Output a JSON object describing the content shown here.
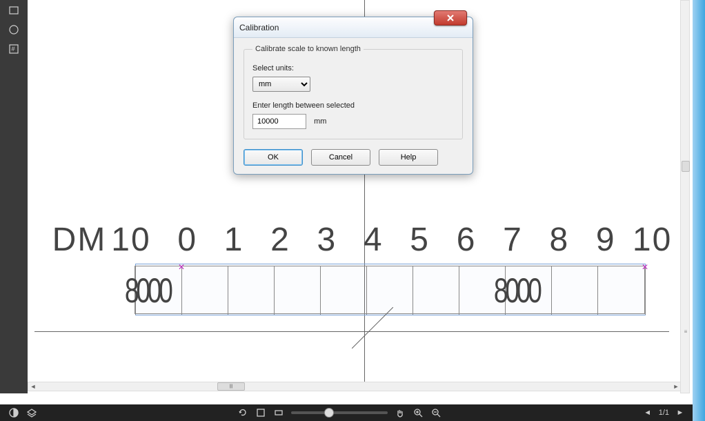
{
  "dialog": {
    "title": "Calibration",
    "group_label": "Calibrate scale to known length",
    "units_label": "Select units:",
    "units_value": "mm",
    "length_label": "Enter length between selected",
    "length_value": "10000",
    "length_suffix": "mm",
    "ok": "OK",
    "cancel": "Cancel",
    "help": "Help"
  },
  "drawing": {
    "prefix": "DM",
    "prefix_num": "10",
    "numbers": [
      "0",
      "1",
      "2",
      "3",
      "4",
      "5",
      "6",
      "7",
      "8",
      "9",
      "10"
    ],
    "left_annot": "8000",
    "right_annot": "8000"
  },
  "status": {
    "page": "1/1"
  }
}
